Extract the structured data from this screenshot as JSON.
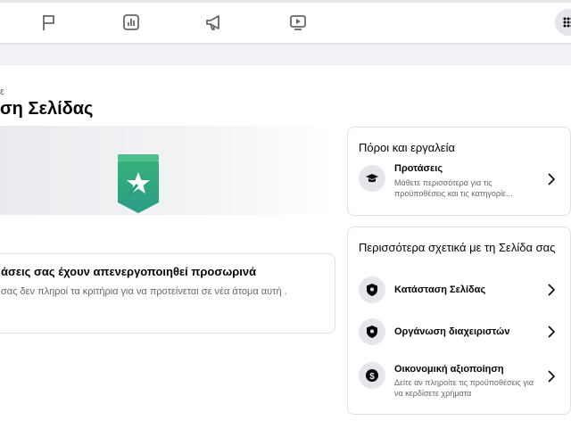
{
  "topbar": {
    "icons": [
      "flag-icon",
      "chart-icon",
      "megaphone-icon",
      "video-icon",
      "menu-grid-icon"
    ]
  },
  "main": {
    "breadcrumb": "ε",
    "title": "ση Σελίδας",
    "notice": {
      "title": "άσεις σας έχουν απενεργοποιηθεί προσωρινά",
      "text": "σας δεν πληροί τα κριτήρια για να προτείνεται σε νέα άτομα αυτή ."
    }
  },
  "resources": {
    "title": "Πόροι και εργαλεία",
    "items": [
      {
        "label": "Προτάσεις",
        "sub": "Μάθετε περισσότερα για τις προϋποθέσεις και τις κατηγορίε...",
        "icon": "graduation-cap-icon"
      }
    ]
  },
  "more": {
    "title": "Περισσότερα σχετικά με τη Σελίδα σας",
    "items": [
      {
        "label": "Κατάσταση Σελίδας",
        "icon": "shield-icon"
      },
      {
        "label": "Οργάνωση διαχειριστών",
        "icon": "shield-icon"
      },
      {
        "label": "Οικονομική αξιοποίηση",
        "sub": "Δείτε αν πληροίτε τις προϋποθέσεις για να κερδίσετε χρήματα",
        "icon": "dollar-icon"
      }
    ]
  },
  "colors": {
    "badge_green": "#2fa36b",
    "badge_teal": "#3aa58c",
    "text_secondary": "#65676b",
    "border": "#dddfe2"
  }
}
